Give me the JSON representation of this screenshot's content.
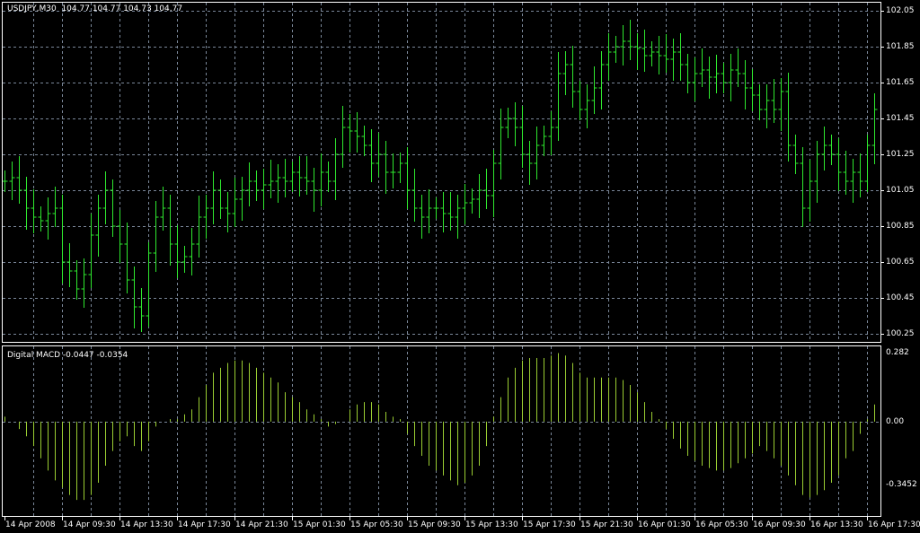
{
  "main_panel": {
    "symbol": "USDJPY,M30",
    "ohlc": [
      "104.77",
      "104.77",
      "104.73",
      "104.77"
    ],
    "price_labels": [
      "102.05",
      "101.85",
      "101.65",
      "101.45",
      "101.25",
      "101.05",
      "100.85",
      "100.65",
      "100.45",
      "100.25"
    ]
  },
  "indicator_panel": {
    "name": "Digital MACD",
    "values": [
      "-0.0447",
      "-0.0354"
    ],
    "labels": [
      "0.282",
      "0.00",
      "-0.3452"
    ]
  },
  "time_labels": [
    "14 Apr 2008",
    "14 Apr 09:30",
    "14 Apr 13:30",
    "14 Apr 17:30",
    "14 Apr 21:30",
    "15 Apr 01:30",
    "15 Apr 05:30",
    "15 Apr 09:30",
    "15 Apr 13:30",
    "15 Apr 17:30",
    "15 Apr 21:30",
    "16 Apr 01:30",
    "16 Apr 05:30",
    "16 Apr 09:30",
    "16 Apr 13:30",
    "16 Apr 17:30"
  ],
  "colors": {
    "bars": "#2ee82e",
    "histogram": "#9acd32",
    "grid": "#7a8799",
    "frame": "#ffffff",
    "background": "#000000"
  },
  "chart_data": {
    "type": "bar",
    "price_range": [
      100.25,
      102.05
    ],
    "closes": [
      101.1,
      101.12,
      101.05,
      100.95,
      100.9,
      100.88,
      100.92,
      100.95,
      100.65,
      100.6,
      100.5,
      100.58,
      100.8,
      100.95,
      101.05,
      100.85,
      100.75,
      100.55,
      100.4,
      100.35,
      100.7,
      100.9,
      100.95,
      100.75,
      100.65,
      100.68,
      100.75,
      100.9,
      100.95,
      101.05,
      100.95,
      100.92,
      101.0,
      101.05,
      101.1,
      101.05,
      101.08,
      101.1,
      101.12,
      101.1,
      101.15,
      101.12,
      101.1,
      101.05,
      101.15,
      101.1,
      101.25,
      101.4,
      101.38,
      101.35,
      101.3,
      101.2,
      101.25,
      101.15,
      101.15,
      101.2,
      101.05,
      100.95,
      100.9,
      100.95,
      100.95,
      100.92,
      100.9,
      100.95,
      100.98,
      101.0,
      101.05,
      101.02,
      101.2,
      101.4,
      101.45,
      101.4,
      101.25,
      101.2,
      101.3,
      101.35,
      101.4,
      101.7,
      101.75,
      101.6,
      101.5,
      101.55,
      101.62,
      101.75,
      101.82,
      101.85,
      101.88,
      101.85,
      101.84,
      101.8,
      101.82,
      101.8,
      101.78,
      101.82,
      101.75,
      101.65,
      101.7,
      101.72,
      101.68,
      101.7,
      101.65,
      101.72,
      101.7,
      101.62,
      101.58,
      101.5,
      101.55,
      101.5,
      101.6,
      101.3,
      101.2,
      100.95,
      101.1,
      101.25,
      101.3,
      101.25,
      101.15,
      101.1,
      101.15,
      101.1,
      101.3,
      101.5
    ],
    "macd_range": [
      -0.3452,
      0.282
    ],
    "macd_histogram": [
      0.02,
      0.0,
      -0.03,
      -0.06,
      -0.1,
      -0.15,
      -0.2,
      -0.24,
      -0.27,
      -0.3,
      -0.32,
      -0.32,
      -0.3,
      -0.25,
      -0.18,
      -0.12,
      -0.08,
      -0.06,
      -0.1,
      -0.12,
      -0.08,
      -0.02,
      0.0,
      0.01,
      0.01,
      0.03,
      0.05,
      0.1,
      0.15,
      0.2,
      0.22,
      0.24,
      0.25,
      0.25,
      0.24,
      0.22,
      0.2,
      0.18,
      0.16,
      0.12,
      0.1,
      0.08,
      0.05,
      0.03,
      0.01,
      -0.02,
      -0.01,
      0.0,
      0.05,
      0.07,
      0.08,
      0.08,
      0.07,
      0.04,
      0.02,
      0.01,
      -0.05,
      -0.1,
      -0.14,
      -0.18,
      -0.2,
      -0.22,
      -0.24,
      -0.26,
      -0.25,
      -0.22,
      -0.18,
      -0.1,
      0.02,
      0.1,
      0.18,
      0.22,
      0.25,
      0.26,
      0.26,
      0.26,
      0.27,
      0.28,
      0.27,
      0.24,
      0.2,
      0.18,
      0.18,
      0.18,
      0.18,
      0.18,
      0.17,
      0.15,
      0.12,
      0.08,
      0.04,
      0.01,
      -0.03,
      -0.07,
      -0.11,
      -0.14,
      -0.16,
      -0.18,
      -0.19,
      -0.2,
      -0.2,
      -0.19,
      -0.17,
      -0.15,
      -0.13,
      -0.1,
      -0.12,
      -0.15,
      -0.18,
      -0.22,
      -0.26,
      -0.3,
      -0.31,
      -0.3,
      -0.28,
      -0.25,
      -0.22,
      -0.15,
      -0.12,
      -0.05,
      0.01,
      0.07
    ]
  }
}
